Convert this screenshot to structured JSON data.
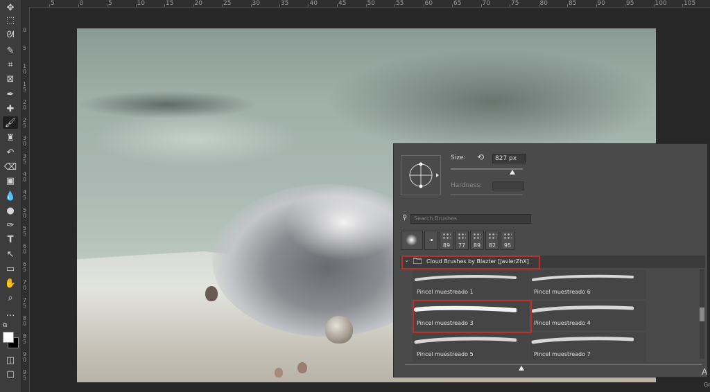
{
  "ruler": {
    "top_labels": [
      "5",
      "0",
      "5",
      "10",
      "15",
      "20",
      "25",
      "30",
      "35",
      "40",
      "45",
      "50",
      "55",
      "60",
      "65",
      "70",
      "75",
      "80",
      "85",
      "90",
      "95",
      "100",
      "105"
    ],
    "left_labels": [
      "0",
      "5",
      "1 0",
      "1 5",
      "2 0",
      "2 5",
      "3 0",
      "3 5",
      "4 0",
      "4 5",
      "5 0",
      "5 5",
      "6 0",
      "6 5",
      "7 0",
      "7 5",
      "8 0",
      "8 5",
      "9 0",
      "9 5"
    ]
  },
  "toolbar": {
    "tools": [
      {
        "name": "move-tool",
        "glyph": "✥"
      },
      {
        "name": "marquee-tool",
        "glyph": "⬚"
      },
      {
        "name": "lasso-tool",
        "glyph": "ᘛ"
      },
      {
        "name": "quick-selection-tool",
        "glyph": "✎"
      },
      {
        "name": "crop-tool",
        "glyph": "⌗"
      },
      {
        "name": "frame-tool",
        "glyph": "⊠"
      },
      {
        "name": "eyedropper-tool",
        "glyph": "✒"
      },
      {
        "name": "healing-brush-tool",
        "glyph": "✚"
      },
      {
        "name": "brush-tool",
        "glyph": "🖌"
      },
      {
        "name": "clone-stamp-tool",
        "glyph": "♜"
      },
      {
        "name": "history-brush-tool",
        "glyph": "↶"
      },
      {
        "name": "eraser-tool",
        "glyph": "⌫"
      },
      {
        "name": "gradient-tool",
        "glyph": "▣"
      },
      {
        "name": "blur-tool",
        "glyph": "💧"
      },
      {
        "name": "dodge-tool",
        "glyph": "●"
      },
      {
        "name": "pen-tool",
        "glyph": "✑"
      },
      {
        "name": "type-tool",
        "glyph": "T"
      },
      {
        "name": "path-selection-tool",
        "glyph": "↖"
      },
      {
        "name": "rectangle-tool",
        "glyph": "▭"
      },
      {
        "name": "hand-tool",
        "glyph": "✋"
      },
      {
        "name": "zoom-tool",
        "glyph": "⌕"
      },
      {
        "name": "more-tools",
        "glyph": "…"
      }
    ]
  },
  "brush_panel": {
    "size_label": "Size:",
    "size_value": "827 px",
    "size_fraction": 0.86,
    "hardness_label": "Hardness:",
    "search_placeholder": "Search Brushes",
    "recent": [
      "",
      "",
      "89",
      "77",
      "89",
      "82",
      "95"
    ],
    "group_name": "Cloud Brushes by Blazter [JavierZhX]",
    "brushes": [
      "Pincel muestreado 1",
      "Pincel muestreado 6",
      "Pincel muestreado 3",
      "Pincel muestreado 4",
      "Pincel muestreado 5",
      "Pincel muestreado 7"
    ],
    "selected_brush": "Pincel muestreado 3"
  },
  "edge": {
    "letter": "A",
    "small": "Gr"
  },
  "colors": {
    "highlight": "#c0302a",
    "panel": "#4a4a4a",
    "foreground": "#ffffff",
    "background": "#000000"
  }
}
